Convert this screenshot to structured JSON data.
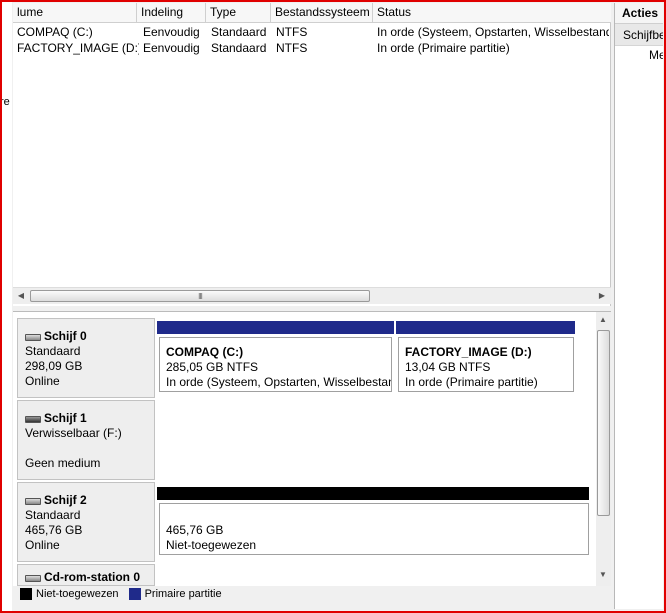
{
  "volume_table": {
    "columns": [
      "lume",
      "Indeling",
      "Type",
      "Bestandssysteem",
      "Status"
    ],
    "rows": [
      [
        "COMPAQ (C:)",
        "Eenvoudig",
        "Standaard",
        "NTFS",
        "In orde (Systeem, Opstarten, Wisselbestand,"
      ],
      [
        "FACTORY_IMAGE (D:)",
        "Eenvoudig",
        "Standaard",
        "NTFS",
        "In orde (Primaire partitie)"
      ]
    ],
    "scroll_grip": "III"
  },
  "edge_text": "re",
  "disks": [
    {
      "name": "Schijf 0",
      "type": "Standaard",
      "size": "298,09 GB",
      "status": "Online",
      "icon": "hard-disk-icon",
      "partitions": [
        {
          "name": "COMPAQ  (C:)",
          "size": "285,05 GB NTFS",
          "status": "In orde (Systeem, Opstarten, Wisselbestand"
        },
        {
          "name": "FACTORY_IMAGE  (D:)",
          "size": "13,04 GB NTFS",
          "status": "In orde (Primaire partitie)"
        }
      ]
    },
    {
      "name": "Schijf 1",
      "type": "Verwisselbaar (F:)",
      "status": "Geen medium",
      "icon": "removable-disk-icon"
    },
    {
      "name": "Schijf 2",
      "type": "Standaard",
      "size": "465,76 GB",
      "status": "Online",
      "icon": "hard-disk-icon",
      "partitions": [
        {
          "size": "465,76 GB",
          "status": "Niet-toegewezen"
        }
      ]
    },
    {
      "name": "Cd-rom-station 0",
      "icon": "cd-rom-icon"
    }
  ],
  "legend": [
    {
      "label": "Niet-toegewezen",
      "color": "#000000"
    },
    {
      "label": "Primaire partitie",
      "color": "#1f2a8a"
    }
  ],
  "actions": {
    "header": "Acties",
    "item1": "Schijfbeheer",
    "item2": "Meer acties"
  },
  "colors": {
    "primary_partition_bar": "#1f2a8a",
    "unallocated_bar": "#000000",
    "window_frame": "#e00000"
  }
}
